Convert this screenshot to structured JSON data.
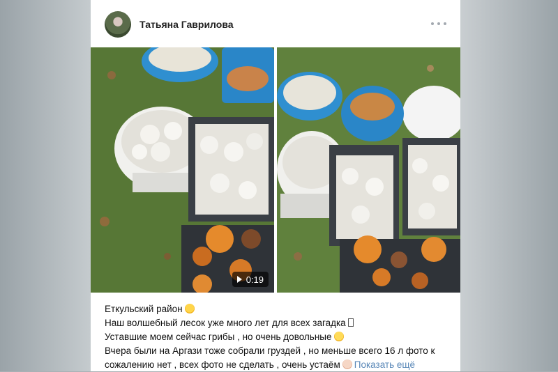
{
  "post": {
    "author": "Татьяна Гаврилова",
    "video_duration": "0:19",
    "text_lines": [
      "Еткульский район",
      "Наш волшебный лесок уже много лет для всех загадка",
      "Уставшие моем сейчас грибы , но очень довольные",
      "Вчера были на Аргази тоже собрали груздей , но меньше всего 16 л фото к",
      "сожалению нет , всех фото не сделать , очень устаём"
    ],
    "show_more": "Показать ещё"
  },
  "icons": {
    "avatar": "user-avatar",
    "more": "more-horizontal-icon",
    "play": "play-icon",
    "emoji_1": "winking-face-emoji",
    "emoji_2": "unknown-glyph",
    "emoji_3": "smiling-face-emoji",
    "emoji_4": "tired-face-emoji"
  },
  "colors": {
    "link": "#5a88b8",
    "text": "#111111",
    "bucket_blue": "#2f8fd0",
    "grass": "#4f7a2f"
  }
}
